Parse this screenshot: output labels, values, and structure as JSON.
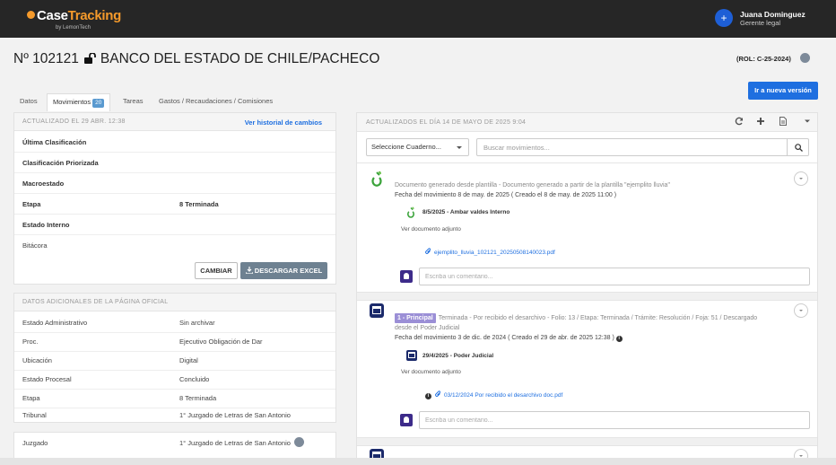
{
  "app": {
    "logo_brand_a": "Case",
    "logo_brand_b": "Tracking",
    "logo_sub": "by LemonTech"
  },
  "user": {
    "name": "Juana Dominguez",
    "role": "Gerente legal",
    "avatar_symbol": "+"
  },
  "case": {
    "number": "Nº 102121",
    "title": "BANCO DEL ESTADO DE CHILE/PACHECO",
    "rol": "(ROL: C-25-2024)"
  },
  "buttons": {
    "version": "Ir a nueva versión",
    "cambiar": "CAMBIAR",
    "excel": "DESCARGAR EXCEL"
  },
  "tabs": [
    {
      "label": "Datos"
    },
    {
      "label": "Movimientos",
      "badge": "20"
    },
    {
      "label": "Tareas"
    },
    {
      "label": "Gastos / Recaudaciones / Comisiones"
    }
  ],
  "left_panel": {
    "header": "ACTUALIZADO EL 29 ABR. 12:38",
    "history_link": "Ver historial de cambios",
    "rows": [
      {
        "label": "Última Clasificación",
        "value": ""
      },
      {
        "label": "Clasificación Priorizada",
        "value": ""
      },
      {
        "label": "Macroestado",
        "value": ""
      },
      {
        "label": "Etapa",
        "value": "8 Terminada"
      },
      {
        "label": "Estado Interno",
        "value": ""
      },
      {
        "label": "Bitácora",
        "value": ""
      }
    ]
  },
  "extra_panel": {
    "header": "DATOS ADICIONALES DE LA PÁGINA OFICIAL",
    "rows": [
      {
        "label": "Estado Administrativo",
        "value": "Sin archivar"
      },
      {
        "label": "Proc.",
        "value": "Ejecutivo Obligación de Dar"
      },
      {
        "label": "Ubicación",
        "value": "Digital"
      },
      {
        "label": "Estado Procesal",
        "value": "Concluido"
      },
      {
        "label": "Etapa",
        "value": "8 Terminada"
      },
      {
        "label": "Tribunal",
        "value": "1° Juzgado de Letras de San Antonio"
      }
    ]
  },
  "juzgado_panel": {
    "label": "Juzgado",
    "value": "1° Juzgado de Letras de San Antonio"
  },
  "right_panel": {
    "header": "ACTUALIZADOS EL DÍA 14 DE MAYO DE 2025 9:04",
    "cuaderno_select": "Seleccione Cuaderno...",
    "search_placeholder": "Buscar movimientos...",
    "comment_placeholder": "Escriba un comentario...",
    "movements": [
      {
        "text_a": "Documento generado desde plantilla - Documento generado a partir de la plantilla \"ejemplito lluvia\"",
        "date": "Fecha del movimiento 8 de may. de 2025 ( Creado el 8 de may. de 2025 11:00 )",
        "sub_author": "8/5/2025 - Ambar valdes Interno",
        "sub_desc": "Ver documento adjunto",
        "attachment": "ejemplito_lluvia_102121_20250508140023.pdf"
      },
      {
        "badge": "1 - Principal",
        "text_a": "Terminada - Por recibido el desarchivo - Folio: 13 / Etapa: Terminada / Trámite: Resolución / Foja: 51 / Descargado",
        "text_b": "desde el Poder Judicial",
        "date": "Fecha del movimiento 3 de dic. de 2024 ( Creado el 29 de abr. de 2025 12:38 )",
        "sub_author": "29/4/2025 - Poder Judicial",
        "sub_desc": "Ver documento adjunto",
        "attachment": "03/12/2024 Por recibido el desarchivo doc.pdf"
      }
    ]
  },
  "colors": {
    "topbar": "#262626",
    "brand_orange": "#f59a2b",
    "primary_blue": "#1e6fe0",
    "excel_button": "#6e8191",
    "principal_badge": "#9b8fd6",
    "pj_icon": "#1b2a6b"
  }
}
